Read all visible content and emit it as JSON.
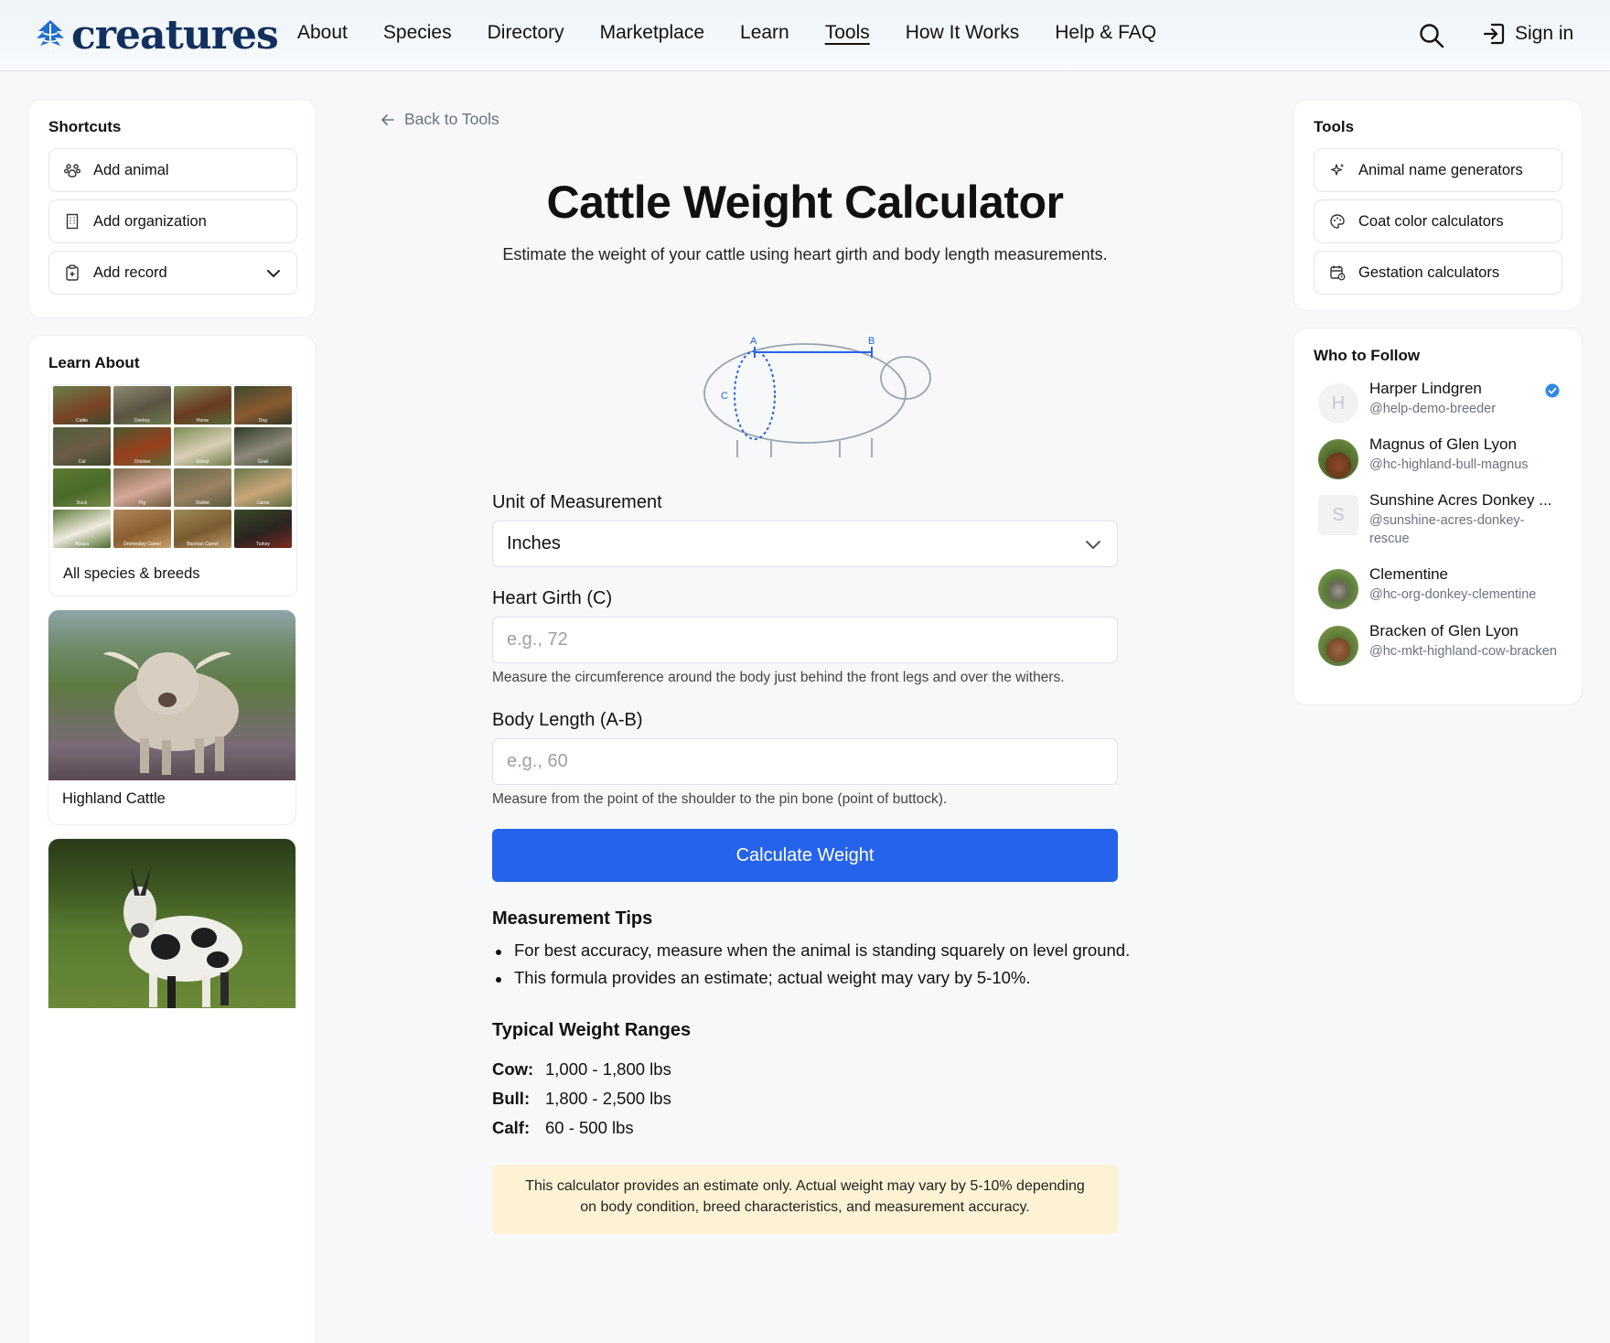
{
  "brand": {
    "name": "creatures"
  },
  "nav": {
    "items": [
      "About",
      "Species",
      "Directory",
      "Marketplace",
      "Learn",
      "Tools",
      "How It Works",
      "Help & FAQ"
    ],
    "active": "Tools",
    "signin": "Sign in"
  },
  "shortcuts": {
    "title": "Shortcuts",
    "add_animal": "Add animal",
    "add_organization": "Add organization",
    "add_record": "Add record"
  },
  "learn": {
    "title": "Learn About",
    "species": [
      "Cattle",
      "Donkey",
      "Horse",
      "Dog",
      "Cat",
      "Chicken",
      "Sheep",
      "Goat",
      "Duck",
      "Pig",
      "Rabbit",
      "Llama",
      "Alpaca",
      "Dromedary Camel",
      "Bactrian Camel",
      "Turkey"
    ],
    "all_label": "All species & breeds",
    "feature1": "Highland Cattle"
  },
  "main": {
    "back": "Back to Tools",
    "title": "Cattle Weight Calculator",
    "subtitle": "Estimate the weight of your cattle using heart girth and body length measurements.",
    "diagram": {
      "a": "A",
      "b": "B",
      "c": "C"
    },
    "unit_label": "Unit of Measurement",
    "unit_value": "Inches",
    "girth_label": "Heart Girth (C)",
    "girth_placeholder": "e.g., 72",
    "girth_hint": "Measure the circumference around the body just behind the front legs and over the withers.",
    "length_label": "Body Length (A-B)",
    "length_placeholder": "e.g., 60",
    "length_hint": "Measure from the point of the shoulder to the pin bone (point of buttock).",
    "button": "Calculate Weight",
    "tips_title": "Measurement Tips",
    "tips": [
      "For best accuracy, measure when the animal is standing squarely on level ground.",
      "This formula provides an estimate; actual weight may vary by 5-10%."
    ],
    "ranges_title": "Typical Weight Ranges",
    "ranges": [
      {
        "k": "Cow:",
        "v": "1,000 - 1,800 lbs"
      },
      {
        "k": "Bull:",
        "v": "1,800 - 2,500 lbs"
      },
      {
        "k": "Calf:",
        "v": "60 - 500 lbs"
      }
    ],
    "note": "This calculator provides an estimate only. Actual weight may vary by 5-10% depending on body condition, breed characteristics, and measurement accuracy."
  },
  "tools": {
    "title": "Tools",
    "items": [
      "Animal name generators",
      "Coat color calculators",
      "Gestation calculators"
    ]
  },
  "follow": {
    "title": "Who to Follow",
    "people": [
      {
        "name": "Harper Lindgren",
        "handle": "@help-demo-breeder",
        "initial": "H"
      },
      {
        "name": "Magnus of Glen Lyon",
        "handle": "@hc-highland-bull-magnus"
      },
      {
        "name": "Sunshine Acres Donkey ...",
        "handle": "@sunshine-acres-donkey-rescue",
        "initial": "S"
      },
      {
        "name": "Clementine",
        "handle": "@hc-org-donkey-clementine"
      },
      {
        "name": "Bracken of Glen Lyon",
        "handle": "@hc-mkt-highland-cow-bracken"
      }
    ]
  },
  "colors": {
    "brand": "#12305e",
    "accent": "#2563eb",
    "note_bg": "#fdf3d4"
  }
}
